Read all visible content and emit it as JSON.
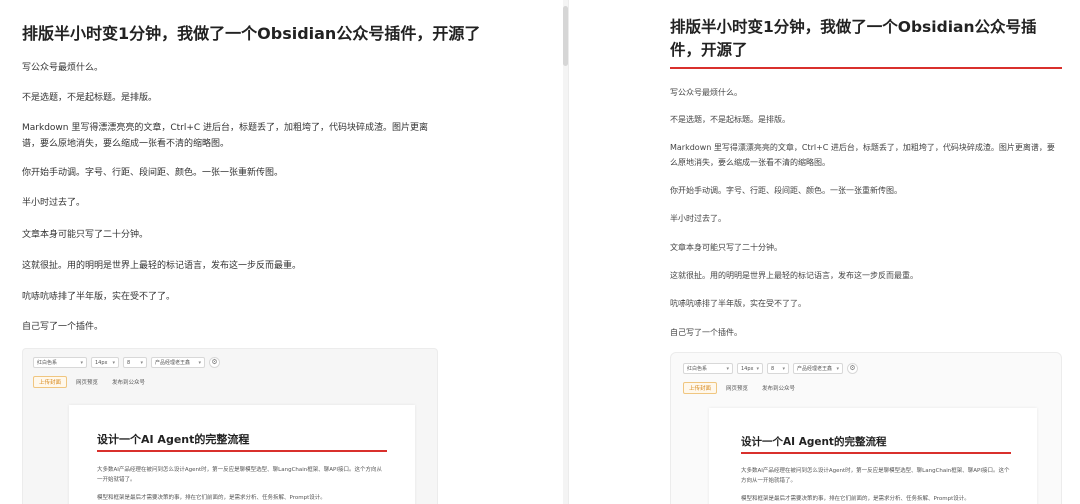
{
  "article": {
    "title": "排版半小时变1分钟，我做了一个Obsidian公众号插件，开源了",
    "paragraphs": [
      "写公众号最烦什么。",
      "不是选题，不是起标题。是排版。",
      "Markdown 里写得漂漂亮亮的文章，Ctrl+C 进后台，标题丢了，加粗垮了，代码块碎成渣。图片更离谱，要么原地消失，要么缩成一张看不清的缩略图。",
      "你开始手动调。字号、行距、段间距、颜色。一张一张重新传图。",
      "半小时过去了。",
      "文章本身可能只写了二十分钟。",
      "这就很扯。用的明明是世界上最轻的标记语言，发布这一步反而最重。",
      "吭哧吭哧排了半年版，实在受不了了。",
      "自己写了一个插件。"
    ]
  },
  "plugin": {
    "theme_select": "红白色系",
    "font_size_select": "14px",
    "spacing_select": "8",
    "account_select": "产品经理老王鑫",
    "settings_icon": "gear-icon",
    "buttons": {
      "upload_cover": "上传封面",
      "web_preview": "网页预览",
      "publish": "发布到公众号"
    },
    "preview": {
      "title": "设计一个AI Agent的完整流程",
      "para1": "大多数AI产品经理在被问到怎么设计Agent时，第一反应是聊模型选型、聊LangChain框架、聊API接口。这个方向从一开始就错了。",
      "para2": "模型和框架是最后才需要决策的事，排在它们前面的，是需求分析、任务拆解、Prompt设计。"
    }
  },
  "colors": {
    "accent_red": "#d9302c",
    "upload_orange": "#d88a1f"
  }
}
